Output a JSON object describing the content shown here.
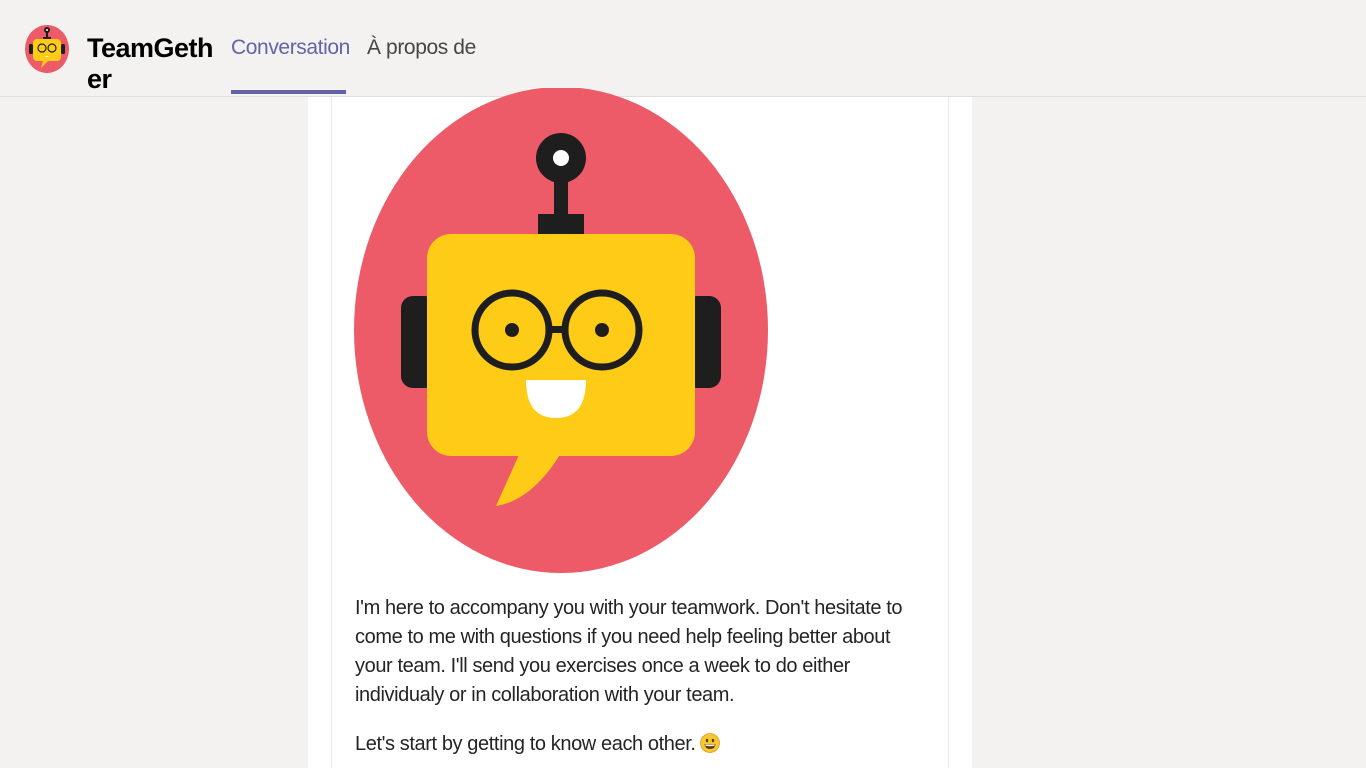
{
  "app": {
    "title": "TeamGether",
    "logo_icon": "robot-logo-icon"
  },
  "tabs": [
    {
      "label": "Conversation",
      "active": true
    },
    {
      "label": "À propos de",
      "active": false
    }
  ],
  "message": {
    "image_icon": "robot-avatar-icon",
    "paragraph_1": "I'm here to accompany you with your teamwork. Don't hesitate to come to me with questions if you need help feeling better about your team. I'll send you exercises once a week to do either individualy or in collaboration with your team.",
    "paragraph_2": "Let's start by getting to know each other.",
    "emoji_icon": "grinning-face-icon"
  },
  "colors": {
    "accent": "#6264a7",
    "bot_red": "#ec5b67",
    "bot_yellow": "#fecb17",
    "bot_dark": "#1e1e1e"
  }
}
